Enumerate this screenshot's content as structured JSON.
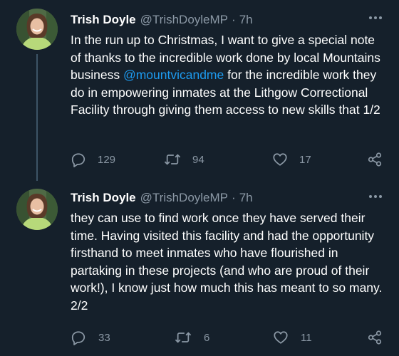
{
  "tweets": [
    {
      "name": "Trish Doyle",
      "handle": "@TrishDoyleMP",
      "separator": "·",
      "time": "7h",
      "text_before": "In the run up to Christmas, I want to give a special note of thanks to the incredible work done by local Mountains business ",
      "mention": "@mountvicandme",
      "text_after": " for the incredible work they do in empowering inmates at the Lithgow Correctional Facility through giving them access to new skills that 1/2",
      "replies": "129",
      "retweets": "94",
      "likes": "17"
    },
    {
      "name": "Trish Doyle",
      "handle": "@TrishDoyleMP",
      "separator": "·",
      "time": "7h",
      "text": "they can use to find work once they have served their time. Having visited this facility and had the opportunity firsthand to meet inmates who have flourished in partaking in these projects (and who are proud of their work!), I know just how much this has meant to so many. 2/2",
      "replies": "33",
      "retweets": "6",
      "likes": "11"
    }
  ],
  "icons": {
    "reply": "reply-icon",
    "retweet": "retweet-icon",
    "like": "heart-icon",
    "share": "share-icon",
    "more": "more-icon"
  },
  "colors": {
    "background": "#15202b",
    "text": "#ffffff",
    "secondary": "#8b98a5",
    "accent": "#1d9bf0",
    "thread_line": "#3d5466"
  }
}
